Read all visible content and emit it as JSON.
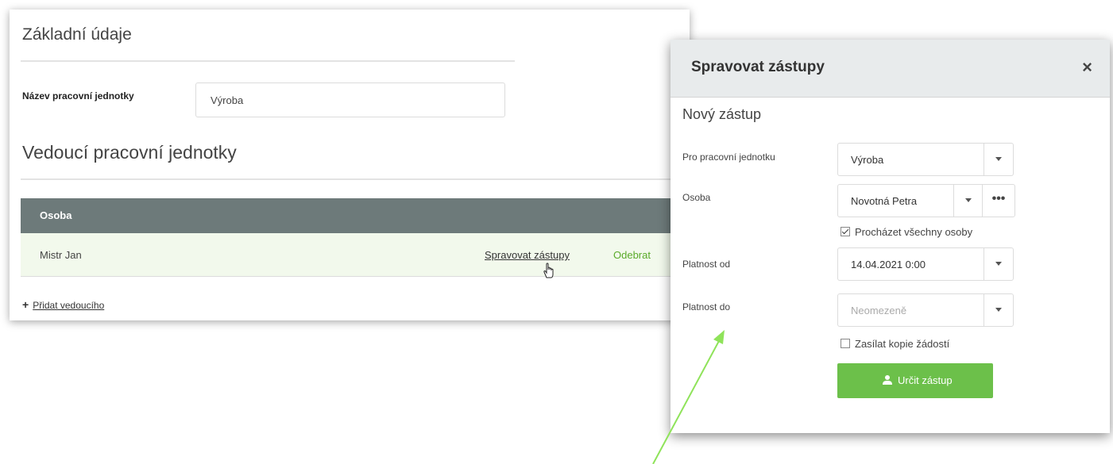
{
  "basic": {
    "section_title": "Základní údaje",
    "unit_name_label": "Název pracovní jednotky",
    "unit_name_value": "Výroba"
  },
  "leaders": {
    "section_title": "Vedoucí pracovní jednotky",
    "table_header": "Osoba",
    "rows": [
      {
        "name": "Mistr Jan",
        "manage_link": "Spravovat zástupy",
        "remove_link": "Odebrat"
      }
    ],
    "add_link": "Přidat vedoucího",
    "add_icon": "+"
  },
  "modal": {
    "title": "Spravovat zástupy",
    "close": "×",
    "subtitle": "Nový zástup",
    "unit_label": "Pro pracovní jednotku",
    "unit_value": "Výroba",
    "person_label": "Osoba",
    "person_value": "Novotná Petra",
    "person_more": "•••",
    "browse_all_label": "Procházet všechny osoby",
    "browse_all_checked": true,
    "valid_from_label": "Platnost od",
    "valid_from_value": "14.04.2021 0:00",
    "valid_to_label": "Platnost do",
    "valid_to_placeholder": "Neomezeně",
    "send_copies_label": "Zasílat kopie žádostí",
    "send_copies_checked": false,
    "submit_label": "Určit zástup"
  },
  "colors": {
    "accent_green": "#6cc04a",
    "table_header_bg": "#6d7a7a",
    "row_highlight": "#f2f9ec",
    "annotation_arrow": "#8fe35a"
  },
  "icons": {
    "close": "close-icon",
    "caret": "chevron-down-icon",
    "more": "more-icon",
    "submit": "user-assign-icon",
    "cursor": "hand-pointer-icon",
    "add": "plus-icon"
  }
}
